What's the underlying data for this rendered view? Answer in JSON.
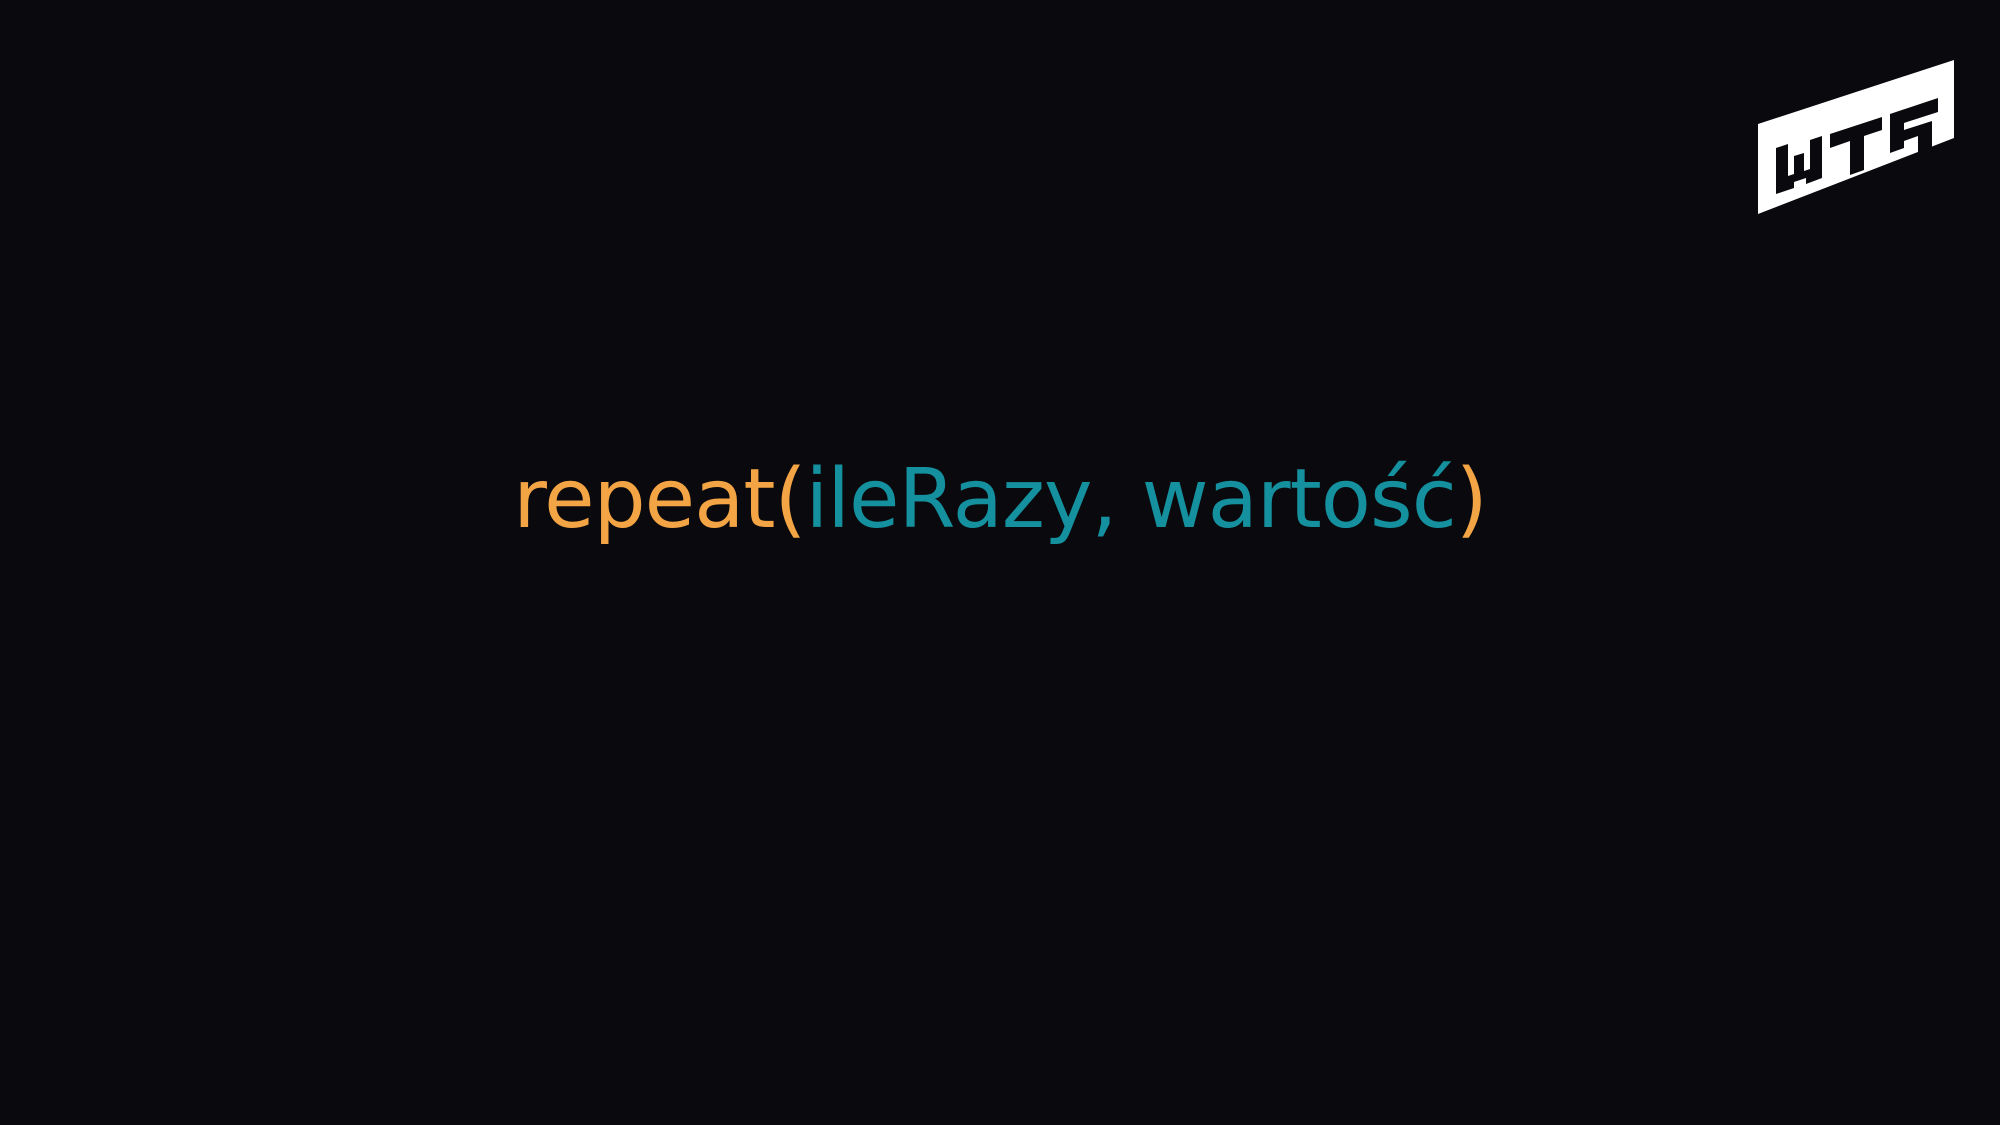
{
  "code": {
    "function_name": "repeat",
    "open_paren": "(",
    "arguments": "ileRazy, wartość",
    "close_paren": ")"
  },
  "logo": {
    "icon": "brand-logo-icon"
  },
  "colors": {
    "background": "#0a090d",
    "function": "#f3a444",
    "arguments": "#15909e",
    "logo": "#ffffff"
  }
}
